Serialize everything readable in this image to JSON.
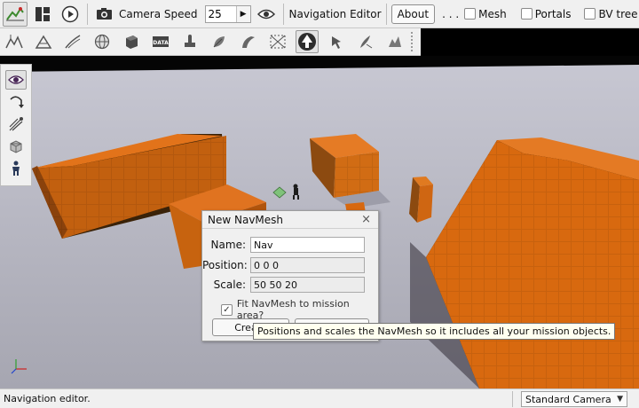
{
  "toolbar": {
    "camera_speed_label": "Camera Speed",
    "camera_speed_value": "25",
    "nav_editor_label": "Navigation Editor",
    "about_label": "About",
    "ellipsis": ". . .",
    "mesh_label": "Mesh",
    "portals_label": "Portals",
    "bvtree_label": "BV tree",
    "icons": [
      "world-editor-icon",
      "layout-icon",
      "play-icon",
      "camera-icon",
      "eye-icon"
    ]
  },
  "toolbar2": {
    "icons": [
      "terrain-editor-icon",
      "terrain-painter-icon",
      "road-editor-icon",
      "globe-icon",
      "shape-icon",
      "datablock-icon",
      "decal-icon",
      "forest-icon",
      "river-icon",
      "mesh-road-icon",
      "navmesh-icon",
      "select-icon",
      "paint-icon",
      "terrain-material-icon",
      "particle-icon"
    ],
    "active_index": 11
  },
  "palette": {
    "icons": [
      "view-icon",
      "rotate-icon",
      "paint-link-icon",
      "cover-icon",
      "actor-icon"
    ]
  },
  "dialog": {
    "title": "New NavMesh",
    "close_glyph": "×",
    "name_label": "Name:",
    "name_value": "Nav",
    "position_label": "Position:",
    "position_value": "0 0 0",
    "scale_label": "Scale:",
    "scale_value": "50 50 20",
    "fit_label": "Fit NavMesh to mission area?",
    "fit_checked": true,
    "create_label": "Create",
    "cancel_label": "Cancel"
  },
  "tooltip": {
    "text": "Positions and scales the NavMesh so it includes all your mission objects."
  },
  "status": {
    "text": "Navigation editor.",
    "camera_mode": "Standard Camera"
  },
  "colors": {
    "box_orange": "#d96a0e",
    "ground": "#b2b2bd",
    "toolbar": "#f0f0f0"
  }
}
